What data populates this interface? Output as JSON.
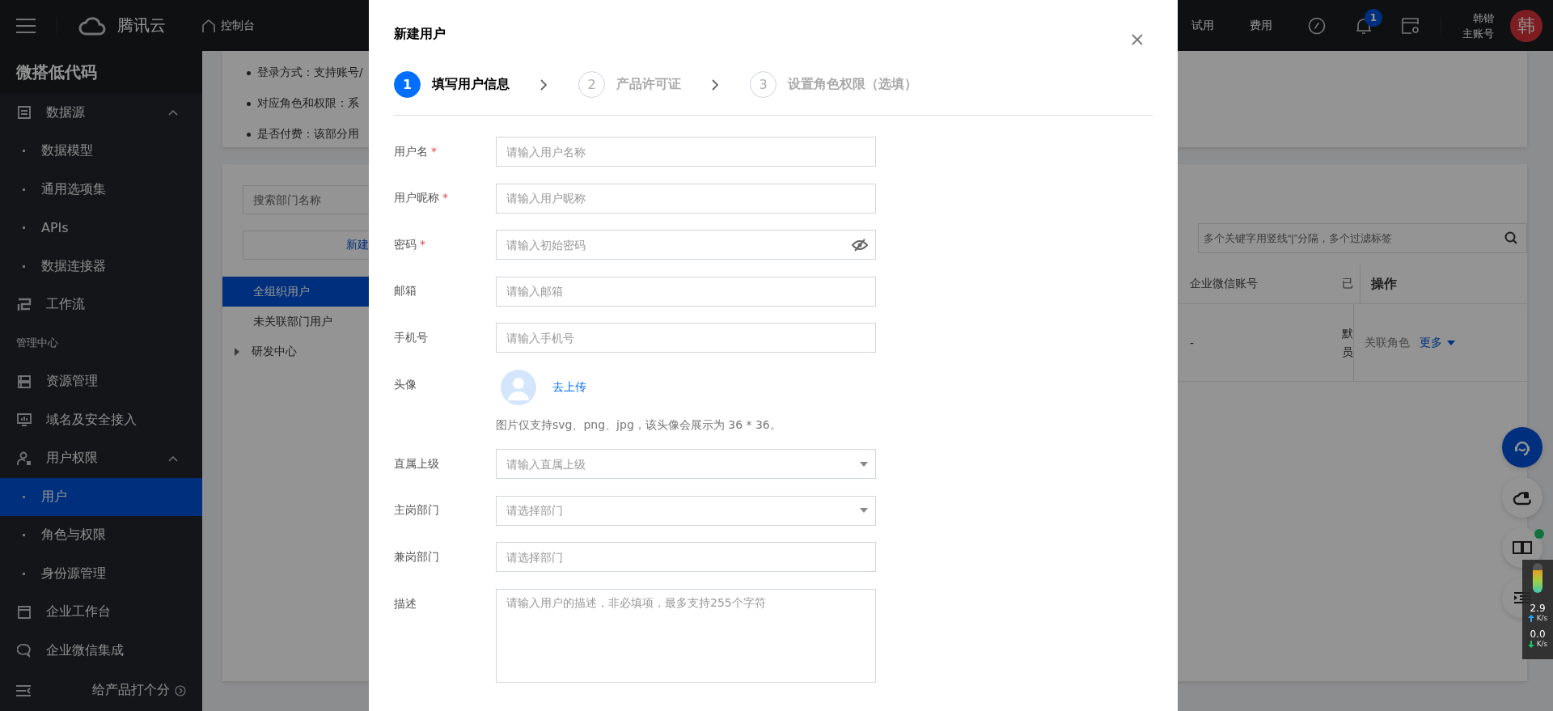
{
  "header": {
    "brand": "腾讯云",
    "console": "控制台",
    "links": [
      "试用",
      "费用"
    ],
    "notification_count": "1",
    "user_name": "韩锴",
    "account_type": "主账号",
    "avatar_text": "韩"
  },
  "sidebar": {
    "title": "微搭低代码",
    "items": [
      {
        "kind": "group",
        "label": "数据源",
        "expanded": true,
        "selected": false
      },
      {
        "kind": "sub",
        "label": "数据模型",
        "selected": false
      },
      {
        "kind": "sub",
        "label": "通用选项集",
        "selected": false
      },
      {
        "kind": "sub",
        "label": "APIs",
        "selected": false
      },
      {
        "kind": "sub",
        "label": "数据连接器",
        "selected": false
      },
      {
        "kind": "group",
        "label": "工作流",
        "selected": false
      },
      {
        "kind": "section",
        "label": "管理中心"
      },
      {
        "kind": "group",
        "label": "资源管理",
        "selected": false
      },
      {
        "kind": "group",
        "label": "域名及安全接入",
        "selected": false
      },
      {
        "kind": "group",
        "label": "用户权限",
        "expanded": true,
        "selected": false
      },
      {
        "kind": "sub",
        "label": "用户",
        "selected": true
      },
      {
        "kind": "sub",
        "label": "角色与权限",
        "selected": false
      },
      {
        "kind": "sub",
        "label": "身份源管理",
        "selected": false
      },
      {
        "kind": "group",
        "label": "企业工作台",
        "selected": false
      },
      {
        "kind": "group",
        "label": "企业微信集成",
        "selected": false
      }
    ],
    "footer": "给产品打个分"
  },
  "notice": [
    "登录方式：支持账号/",
    "对应角色和权限：系",
    "是否付费：该部分用"
  ],
  "dept_panel": {
    "search": {
      "placeholder": "搜索部门名称"
    },
    "new_button": "新建",
    "tree": [
      {
        "label": "全组织用户",
        "selected": true
      },
      {
        "label": "未关联部门用户",
        "selected": false
      },
      {
        "label": "研发中心",
        "selected": false,
        "expanded": false
      }
    ]
  },
  "user_table": {
    "search": {
      "placeholder": "多个关键字用竖线“|”分隔，多个过滤标签"
    },
    "columns": [
      "企业微信账号",
      "已",
      "操作"
    ],
    "rows": [
      {
        "cells": [
          "-",
          "默员"
        ],
        "actions": [
          {
            "label": "关联角色",
            "disabled": true,
            "kind": "link"
          },
          {
            "label": "更多",
            "disabled": false,
            "kind": "dropdown"
          }
        ]
      }
    ]
  },
  "modal": {
    "title": "新建用户",
    "required_mark": "*",
    "steps": [
      {
        "number": "1",
        "label": "填写用户信息",
        "selected": true
      },
      {
        "number": "2",
        "label": "产品许可证",
        "selected": false
      },
      {
        "number": "3",
        "label": "设置角色权限（选填）",
        "selected": false
      }
    ],
    "fields": [
      {
        "kind": "text",
        "label": "用户名",
        "required": true,
        "placeholder": "请输入用户名称"
      },
      {
        "kind": "text",
        "label": "用户昵称",
        "required": true,
        "placeholder": "请输入用户昵称"
      },
      {
        "kind": "password",
        "label": "密码",
        "required": true,
        "placeholder": "请输入初始密码"
      },
      {
        "kind": "text",
        "label": "邮箱",
        "required": false,
        "placeholder": "请输入邮箱"
      },
      {
        "kind": "text",
        "label": "手机号",
        "required": false,
        "placeholder": "请输入手机号"
      },
      {
        "kind": "avatar",
        "label": "头像",
        "required": false,
        "link": "去上传",
        "hint": "图片仅支持svg、png、jpg，该头像会展示为 36 * 36。"
      },
      {
        "kind": "select",
        "label": "直属上级",
        "required": false,
        "placeholder": "请输入直属上级"
      },
      {
        "kind": "select",
        "label": "主岗部门",
        "required": false,
        "placeholder": "请选择部门"
      },
      {
        "kind": "text",
        "label": "兼岗部门",
        "required": false,
        "placeholder": "请选择部门"
      },
      {
        "kind": "textarea",
        "label": "描述",
        "required": false,
        "placeholder": "请输入用户的描述，非必填项，最多支持255个字符"
      }
    ]
  },
  "net_monitor": {
    "level": 0.75,
    "upload": {
      "value": "2.9",
      "unit": "K/s"
    },
    "download": {
      "value": "0.0",
      "unit": "K/s"
    }
  }
}
